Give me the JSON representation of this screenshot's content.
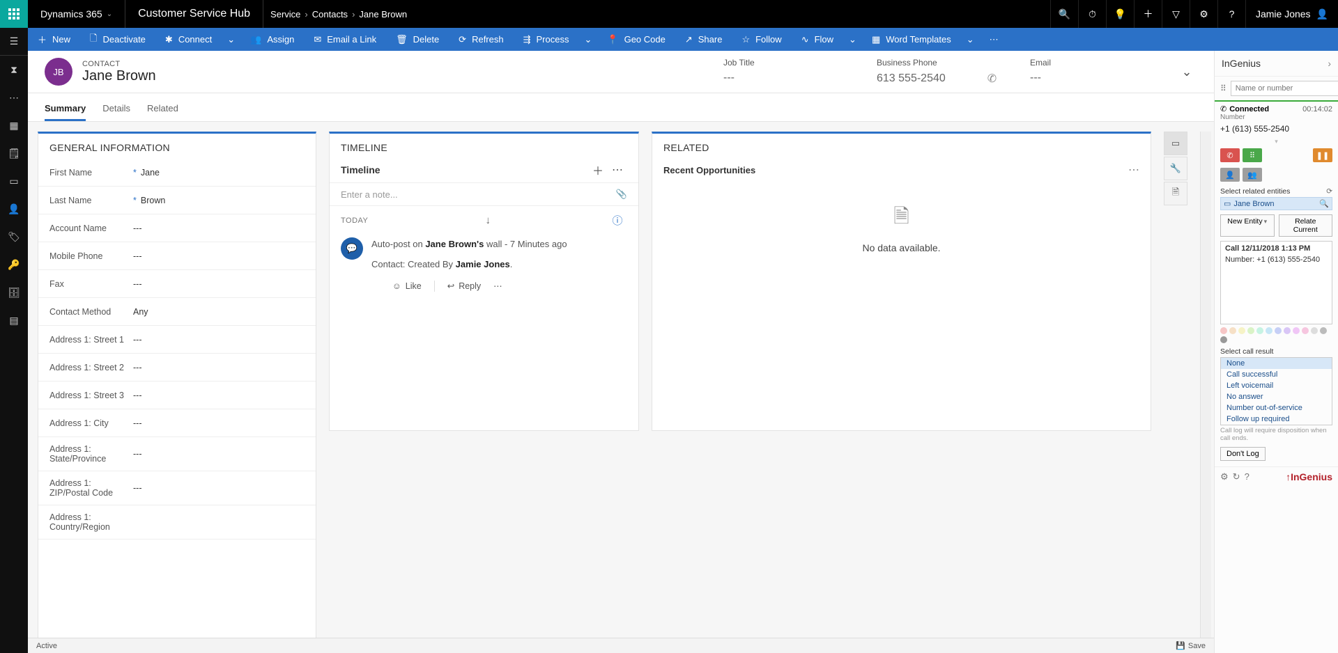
{
  "topbar": {
    "brand": "Dynamics 365",
    "hub": "Customer Service Hub",
    "crumbs": [
      "Service",
      "Contacts",
      "Jane Brown"
    ],
    "user": "Jamie Jones"
  },
  "cmdbar": {
    "new": "New",
    "deactivate": "Deactivate",
    "connect": "Connect",
    "assign": "Assign",
    "email_link": "Email a Link",
    "delete": "Delete",
    "refresh": "Refresh",
    "process": "Process",
    "geocode": "Geo Code",
    "share": "Share",
    "follow": "Follow",
    "flow": "Flow",
    "word_templates": "Word Templates"
  },
  "record": {
    "initials": "JB",
    "entity_type": "CONTACT",
    "name": "Jane Brown",
    "fields": {
      "job_title_label": "Job Title",
      "job_title_value": "---",
      "business_phone_label": "Business Phone",
      "business_phone_value": "613 555-2540",
      "email_label": "Email",
      "email_value": "---"
    }
  },
  "tabs": {
    "summary": "Summary",
    "details": "Details",
    "related": "Related"
  },
  "general": {
    "header": "GENERAL INFORMATION",
    "rows": [
      {
        "label": "First Name",
        "value": "Jane",
        "required": true
      },
      {
        "label": "Last Name",
        "value": "Brown",
        "required": true
      },
      {
        "label": "Account Name",
        "value": "---"
      },
      {
        "label": "Mobile Phone",
        "value": "---"
      },
      {
        "label": "Fax",
        "value": "---"
      },
      {
        "label": "Contact Method",
        "value": "Any"
      },
      {
        "label": "Address 1: Street 1",
        "value": "---"
      },
      {
        "label": "Address 1: Street 2",
        "value": "---"
      },
      {
        "label": "Address 1: Street 3",
        "value": "---"
      },
      {
        "label": "Address 1: City",
        "value": "---"
      },
      {
        "label": "Address 1: State/Province",
        "value": "---"
      },
      {
        "label": "Address 1: ZIP/Postal Code",
        "value": "---"
      },
      {
        "label": "Address 1: Country/Region",
        "value": ""
      }
    ]
  },
  "timeline": {
    "header": "TIMELINE",
    "subtitle": "Timeline",
    "note_placeholder": "Enter a note...",
    "today": "TODAY",
    "post": {
      "prefix": "Auto-post on ",
      "name": "Jane Brown's",
      "suffix": "  wall  -  ",
      "time": "7 Minutes ago",
      "line2a": "Contact: Created By ",
      "line2b": "Jamie Jones",
      "like": "Like",
      "reply": "Reply"
    }
  },
  "related": {
    "header": "RELATED",
    "subtitle": "Recent Opportunities",
    "nodata": "No data available."
  },
  "status": {
    "active": "Active",
    "save": "Save"
  },
  "ingenius": {
    "title": "InGenius",
    "search_placeholder": "Name or number",
    "connected": "Connected",
    "timer": "00:14:02",
    "number_label": "Number",
    "number_value": "+1 (613) 555-2540",
    "select_related": "Select related entities",
    "entity": "Jane Brown",
    "new_entity": "New Entity",
    "relate_current": "Relate Current",
    "log_title": "Call 12/11/2018 1:13 PM",
    "log_number": "Number: +1 (613) 555-2540",
    "select_call_result": "Select call result",
    "results": [
      "None",
      "Call successful",
      "Left voicemail",
      "No answer",
      "Number out-of-service",
      "Follow up required"
    ],
    "hint": "Call log will require disposition when call ends.",
    "dont_log": "Don't Log",
    "brand": "InGenius",
    "colors": [
      "#f6c6c6",
      "#f6e0c6",
      "#f6f3c6",
      "#d9f3c6",
      "#c6f3e3",
      "#c6e6f6",
      "#c6cff6",
      "#d9c6f6",
      "#f0c6f6",
      "#f6c6df",
      "#dddddd",
      "#bbbbbb",
      "#999999"
    ]
  }
}
